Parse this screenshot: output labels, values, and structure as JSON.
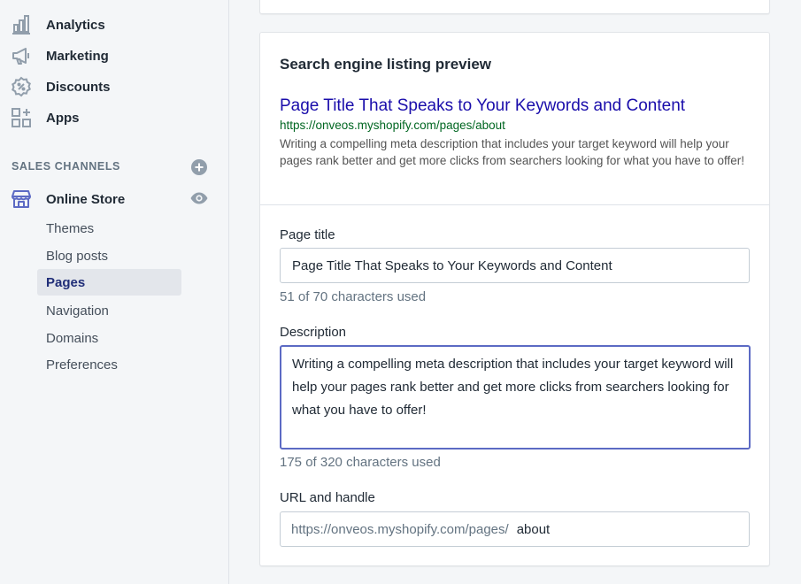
{
  "sidebar": {
    "items": [
      {
        "label": "Analytics",
        "icon": "analytics-icon"
      },
      {
        "label": "Marketing",
        "icon": "megaphone-icon"
      },
      {
        "label": "Discounts",
        "icon": "discount-badge-icon"
      },
      {
        "label": "Apps",
        "icon": "apps-grid-icon"
      }
    ],
    "sales_channels_heading": "SALES CHANNELS",
    "online_store": {
      "label": "Online Store",
      "sub_items": [
        {
          "label": "Themes"
        },
        {
          "label": "Blog posts"
        },
        {
          "label": "Pages"
        },
        {
          "label": "Navigation"
        },
        {
          "label": "Domains"
        },
        {
          "label": "Preferences"
        }
      ],
      "active_sub_item": "Pages"
    },
    "colors": {
      "active_text": "#202e78",
      "active_bg": "#e3e6eb",
      "icon": "#919eab"
    }
  },
  "seo": {
    "title": "Search engine listing preview",
    "preview": {
      "title": "Page Title That Speaks to Your Keywords and Content",
      "url": "https://onveos.myshopify.com/pages/about",
      "description": "Writing a compelling meta description that includes your target keyword will help your pages rank better and get more clicks from searchers looking for what you have to offer!"
    },
    "page_title_field": {
      "label": "Page title",
      "value": "Page Title That Speaks to Your Keywords and Content",
      "help": "51 of 70 characters used"
    },
    "description_field": {
      "label": "Description",
      "value": "Writing a compelling meta description that includes your target keyword will help your pages rank better and get more clicks from searchers looking for what you have to offer!",
      "help": "175 of 320 characters used"
    },
    "url_field": {
      "label": "URL and handle",
      "prefix": "https://onveos.myshopify.com/pages/",
      "handle": "about"
    },
    "colors": {
      "link_title": "#1a0dab",
      "link_url": "#006621",
      "focus_border": "#5c6ac4"
    }
  }
}
